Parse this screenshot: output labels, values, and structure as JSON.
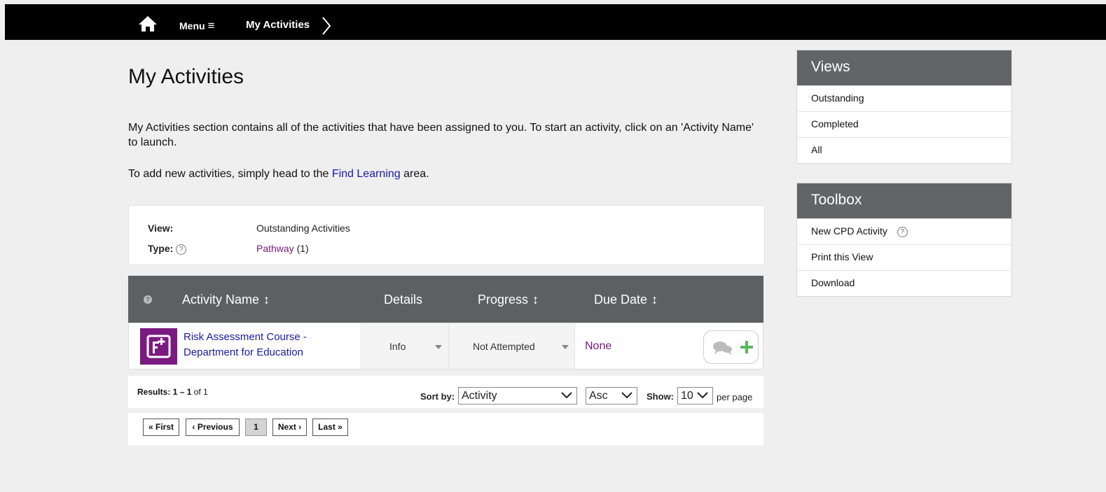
{
  "topbar": {
    "home_icon": "home-icon",
    "menu_label": "Menu",
    "menu_icon": "≡",
    "breadcrumb": "My Activities"
  },
  "page": {
    "title": "My Activities",
    "intro_text": "My Activities section contains all of the activities that have been assigned to you. To start an activity, click on an 'Activity Name' to launch.",
    "add_prefix": "To add new activities, simply head to the",
    "add_link": "Find Learning",
    "add_suffix": "area."
  },
  "filter": {
    "view_label": "View:",
    "view_value": "Outstanding Activities",
    "type_label": "Type:",
    "type_value": "Pathway",
    "type_count": "(1)",
    "help_glyph": "?"
  },
  "table": {
    "help_glyph": "?",
    "headers": {
      "activity": "Activity Name",
      "details": "Details",
      "progress": "Progress",
      "due": "Due Date",
      "sort_glyph": "↕"
    },
    "rows": [
      {
        "activity_name": "Risk Assessment Course - Department for Education",
        "details": "Info",
        "progress": "Not Attempted",
        "due": "None",
        "icon": "pathway-icon"
      }
    ]
  },
  "results": {
    "label": "Results:",
    "range": "1 – 1",
    "of_text": "of 1",
    "sort_by_label": "Sort by:",
    "sort_by_value": "Activity",
    "order_value": "Asc",
    "show_label": "Show:",
    "show_value": "10",
    "per_page": "per page"
  },
  "pager": {
    "first": "« First",
    "previous": "‹ Previous",
    "current": "1",
    "next": "Next ›",
    "last": "Last »"
  },
  "views_panel": {
    "title": "Views",
    "items": [
      "Outstanding",
      "Completed",
      "All"
    ]
  },
  "toolbox_panel": {
    "title": "Toolbox",
    "items": [
      "New CPD Activity",
      "Print this View",
      "Download"
    ],
    "help_glyph": "?"
  },
  "colors": {
    "header_bg": "#000000",
    "panel_head": "#636466",
    "table_head": "#5e5f62",
    "link": "#1a1aa6",
    "accent_purple": "#7a1a80",
    "add_green": "#5cb85c"
  }
}
